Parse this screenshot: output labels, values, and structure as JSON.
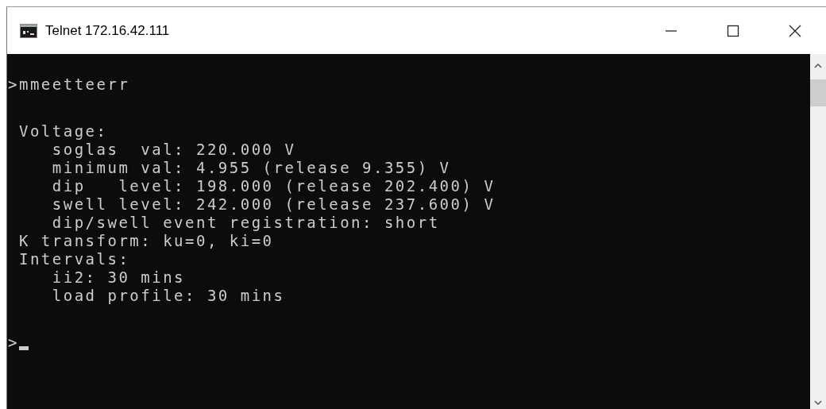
{
  "window": {
    "title": "Telnet 172.16.42.111"
  },
  "terminal": {
    "blocks": [
      [
        ">mmeetteerr"
      ],
      [
        " Voltage:",
        "    soglas  val: 220.000 V",
        "    minimum val: 4.955 (release 9.355) V",
        "    dip   level: 198.000 (release 202.400) V",
        "    swell level: 242.000 (release 237.600) V",
        "    dip/swell event registration: short",
        " K transform: ku=0, ki=0",
        " Intervals:",
        "    ii2: 30 mins",
        "    load profile: 30 mins"
      ]
    ],
    "prompt": ">"
  }
}
